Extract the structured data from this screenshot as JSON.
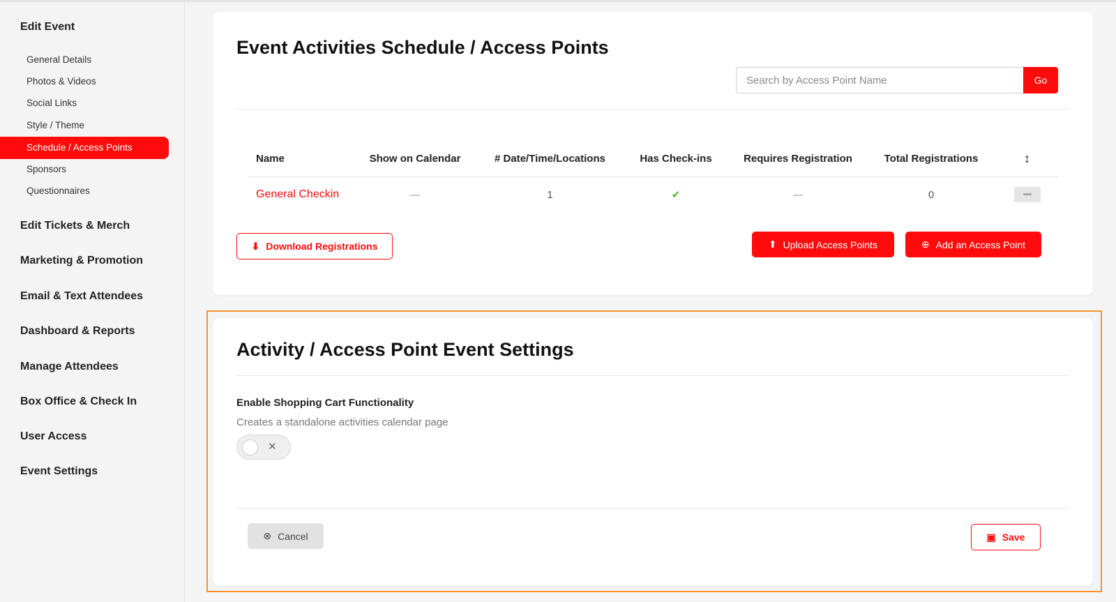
{
  "sidebar": {
    "edit_event": "Edit Event",
    "sub_items": [
      "General Details",
      "Photos & Videos",
      "Social Links",
      "Style / Theme",
      "Schedule / Access Points",
      "Sponsors",
      "Questionnaires"
    ],
    "active_sub_item": "Schedule / Access Points",
    "sections": [
      "Edit Tickets & Merch",
      "Marketing & Promotion",
      "Email & Text Attendees",
      "Dashboard & Reports",
      "Manage Attendees",
      "Box Office & Check In",
      "User Access",
      "Event Settings"
    ]
  },
  "schedule_card": {
    "title": "Event Activities Schedule / Access Points",
    "search_placeholder": "Search by Access Point Name",
    "go_label": "Go",
    "columns": [
      "Name",
      "Show on Calendar",
      "# Date/Time/Locations",
      "Has Check-ins",
      "Requires Registration",
      "Total Registrations"
    ],
    "rows": [
      {
        "name": "General Checkin",
        "show_on_calendar": false,
        "date_time_locations": "1",
        "has_checkins": true,
        "requires_registration": false,
        "total_registrations": "0"
      }
    ],
    "download_label": "Download Registrations",
    "upload_label": "Upload Access Points",
    "add_label": "Add an Access Point"
  },
  "settings_card": {
    "title": "Activity / Access Point Event Settings",
    "setting_label": "Enable Shopping Cart Functionality",
    "setting_help": "Creates a standalone activities calendar page",
    "toggle_enabled": false,
    "cancel_label": "Cancel",
    "save_label": "Save"
  },
  "colors": {
    "accent": "#ff0b0b",
    "highlight_border": "#f7922a",
    "check_green": "#57b12a"
  },
  "icons": [
    "download-icon",
    "upload-icon",
    "plus-circle-icon",
    "sort-vertical-icon",
    "drag-handle-icon",
    "check-icon",
    "times-circle-icon",
    "save-icon",
    "toggle-x-icon"
  ]
}
